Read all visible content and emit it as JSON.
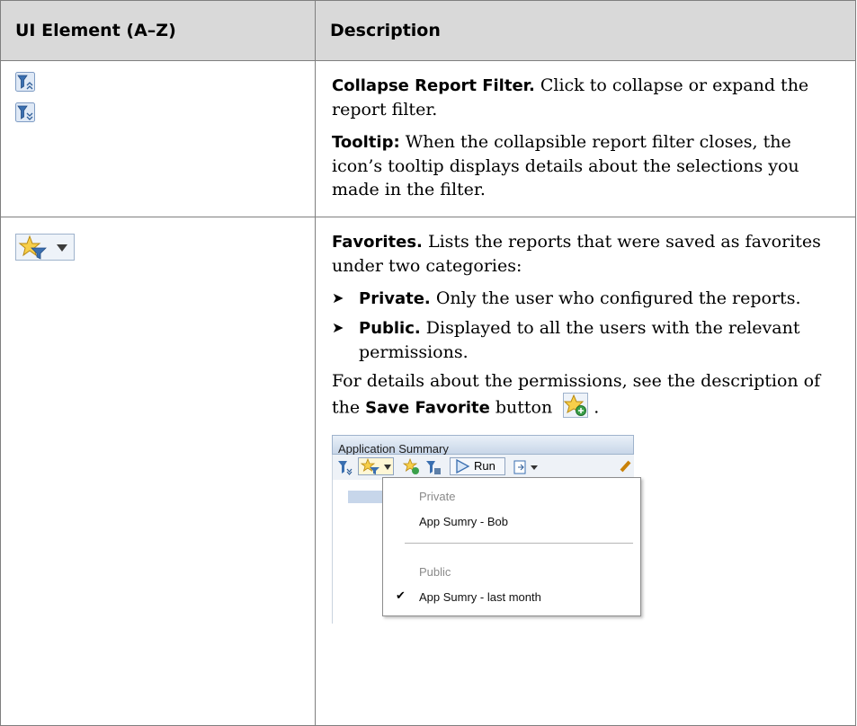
{
  "table": {
    "headers": [
      "UI Element (A–Z)",
      "Description"
    ],
    "row1": {
      "icons": [
        "collapse-filter-up-icon",
        "collapse-filter-down-icon"
      ],
      "title": "Collapse Report Filter.",
      "text": " Click to collapse or expand the report filter.",
      "tooltip_label": "Tooltip:",
      "tooltip_text": " When the collapsible report filter closes, the icon’s tooltip displays details about the selections you made in the filter."
    },
    "row2": {
      "icons": [
        "favorites-star-filter-icon",
        "dropdown-arrow-icon"
      ],
      "title": "Favorites.",
      "text": " Lists the reports that were saved as favorites under two categories:",
      "bullets": [
        {
          "marker": "➤",
          "label": "Private.",
          "text": " Only the user who configured the reports."
        },
        {
          "marker": "➤",
          "label": "Public.",
          "text": " Displayed to all the users with the relevant permissions."
        }
      ],
      "details_text": "For details about the permissions, see the description of the ",
      "details_bold": "Save Favorite",
      "details_after": " button",
      "details_end": ".",
      "save_favorite_icon": "save-favorite-icon",
      "screenshot": {
        "title": "Application Summary",
        "run_label": "Run",
        "menu": {
          "private_header": "Private",
          "private_item": "App Sumry - Bob",
          "public_header": "Public",
          "public_item": "App Sumry - last month",
          "check": "✔"
        }
      }
    }
  },
  "colors": {
    "header_bg": "#d9d9d9",
    "border": "#7f7f7f",
    "icon_blue": "#3a6fb0",
    "star_gold": "#f2b41c"
  }
}
